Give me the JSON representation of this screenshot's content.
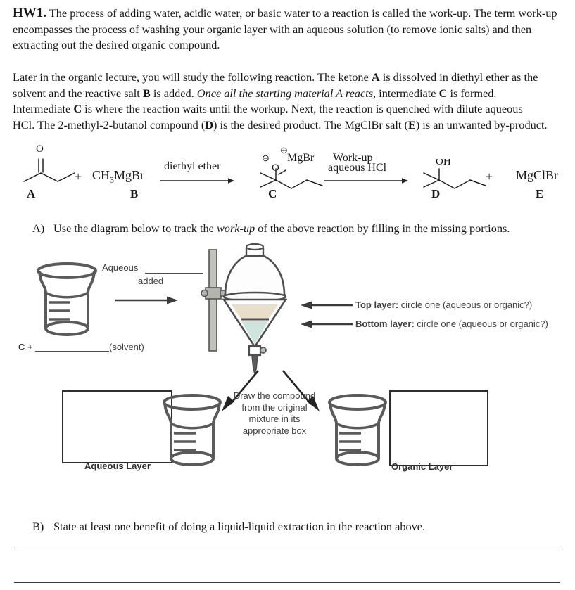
{
  "document": {
    "title": "HW1",
    "intro": {
      "heading": "HW1.",
      "line1": "The process of adding water, acidic water, or basic water to a reaction is called the",
      "underlined_term": "work-up.",
      "line2": "The term work-up encompasses the process of washing your organic layer with an",
      "line3": "aqueous solution (to remove ionic salts) and then extracting out the desired organic compound."
    },
    "reaction_paragraph": {
      "seg1": "Later in the organic lecture, you will study the following reaction. The ketone ",
      "bold1": "A",
      "seg2": " is dissolved in diethyl ether as the solvent and the reactive salt ",
      "bold2": "B",
      "seg3": " is added. ",
      "italic1": "Once all the starting material A reacts",
      "seg4": ", intermediate ",
      "bold3": "C",
      "seg5": " is formed. Intermediate ",
      "bold4": "C",
      "seg6": " is where the reaction waits until the workup. Next, the reaction is quenched with dilute aqueous HCl. The 2-methyl-2-butanol compound (",
      "bold5": "D",
      "seg7": ") is the desired product.  The MgClBr salt (",
      "bold6": "E",
      "seg8": ") is an unwanted by-product."
    }
  },
  "reaction_scheme": {
    "compound_a_label": "A",
    "compound_b_label": "B",
    "compound_c_label": "C",
    "compound_d_label": "D",
    "compound_e_label": "E",
    "plus_1": "+",
    "plus_2": "+",
    "reagent_b_formula_pre": "CH",
    "reagent_b_formula_sub": "3",
    "reagent_b_formula_post": "MgBr",
    "arrow1_label": "diethyl ether",
    "arrow2_label_line1": "Work-up",
    "arrow2_label_line2": "aqueous HCl",
    "c_counterion": "MgBr",
    "c_negative_charge": "⊖",
    "c_positive_charge": "⊕",
    "c_oxygen": "O",
    "d_hydroxyl": "OH",
    "e_formula": "MgClBr",
    "a_oxygen": "O"
  },
  "questions": {
    "a": {
      "label": "A)",
      "text_pre": "Use the diagram below to track the ",
      "text_italic": "work-up",
      "text_post": " of the above reaction by filling in the missing portions."
    },
    "b": {
      "label": "B)",
      "text": "State at least one benefit of doing a liquid-liquid extraction in the reaction above."
    }
  },
  "workup_diagram": {
    "aqueous_added_line1": "Aqueous",
    "aqueous_added_line2": "added",
    "start_beaker_caption_pre": "C +",
    "start_beaker_caption_post": "(solvent)",
    "top_layer_label_bold": "Top layer:",
    "top_layer_label_rest": " circle one (aqueous or organic?)",
    "bottom_layer_label_bold": "Bottom layer:",
    "bottom_layer_label_rest": " circle one (aqueous or organic?)",
    "draw_instruction": "Draw the compound from the original mixture in its appropriate box",
    "aqueous_layer_caption": "Aqueous Layer",
    "organic_layer_caption": "Organic Layer",
    "colors": {
      "top_layer_fill": "#e9dec9",
      "bottom_layer_fill": "#cfe3df",
      "glass_stroke": "#4e4e4e",
      "beaker_stroke": "#5a5a5a",
      "arrow_color": "#3b3b3b",
      "stand_fill": "#b9b9b4"
    }
  }
}
